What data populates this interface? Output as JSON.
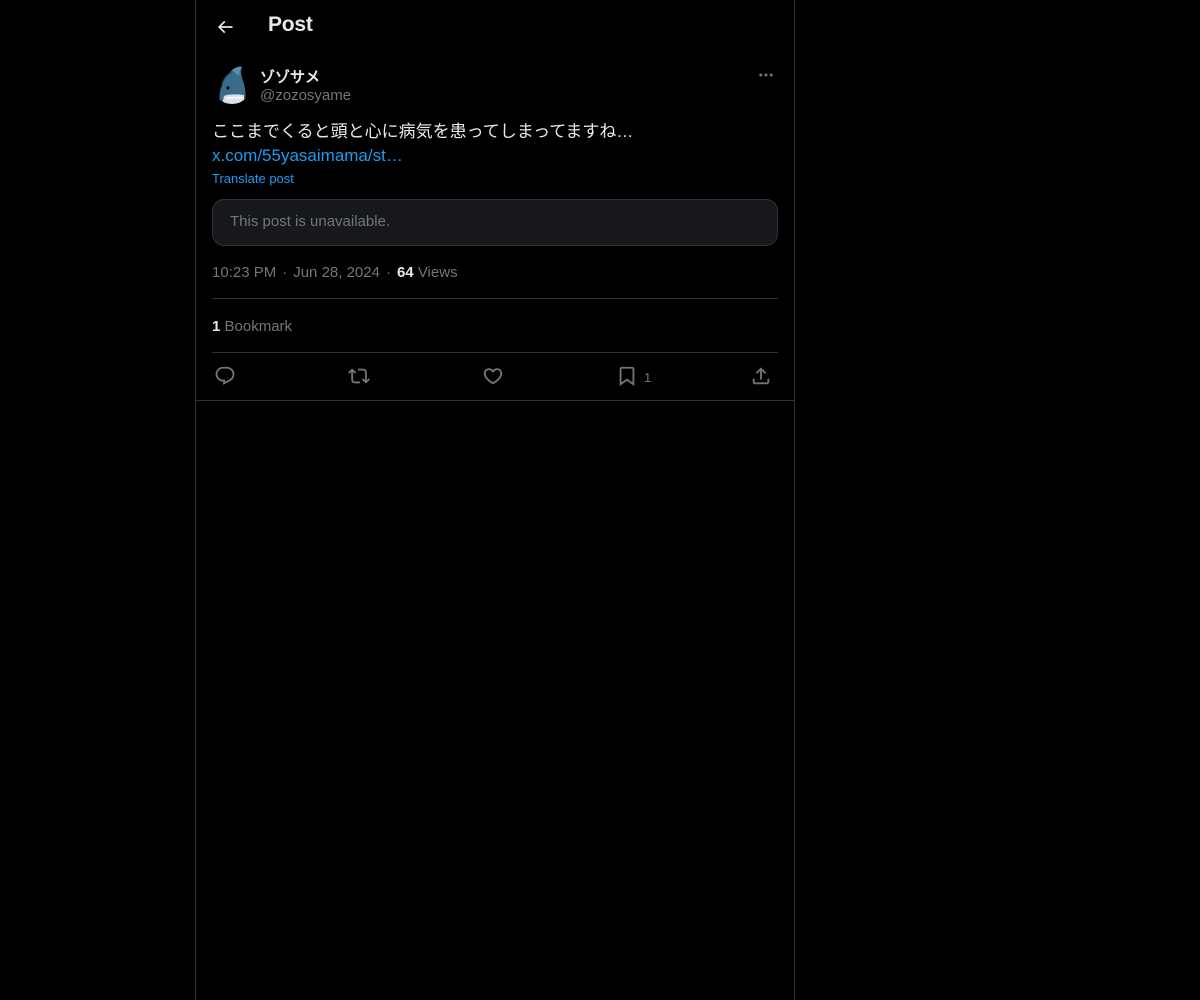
{
  "header": {
    "title": "Post",
    "back_icon": "arrow-left-icon"
  },
  "post": {
    "author": {
      "name": "ゾゾサメ",
      "handle": "@zozosyame",
      "avatar_icon": "shark-avatar"
    },
    "text": "ここまでくると頭と心に病気を患ってしまってますね…",
    "link": "x.com/55yasaimama/st…",
    "translate_label": "Translate post",
    "quoted_unavailable": "This post is unavailable.",
    "time": "10:23 PM",
    "date": "Jun 28, 2024",
    "views_count": "64",
    "views_label": "Views",
    "bookmarks_count": "1",
    "bookmarks_label": "Bookmark"
  },
  "actions": {
    "reply_icon": "reply-icon",
    "repost_icon": "repost-icon",
    "like_icon": "heart-icon",
    "bookmark_icon": "bookmark-icon",
    "bookmark_count": "1",
    "share_icon": "share-icon"
  },
  "colors": {
    "background": "#000000",
    "text_primary": "#e7e9ea",
    "text_secondary": "#71767b",
    "accent": "#1d9bf0",
    "border": "#2f3336"
  }
}
